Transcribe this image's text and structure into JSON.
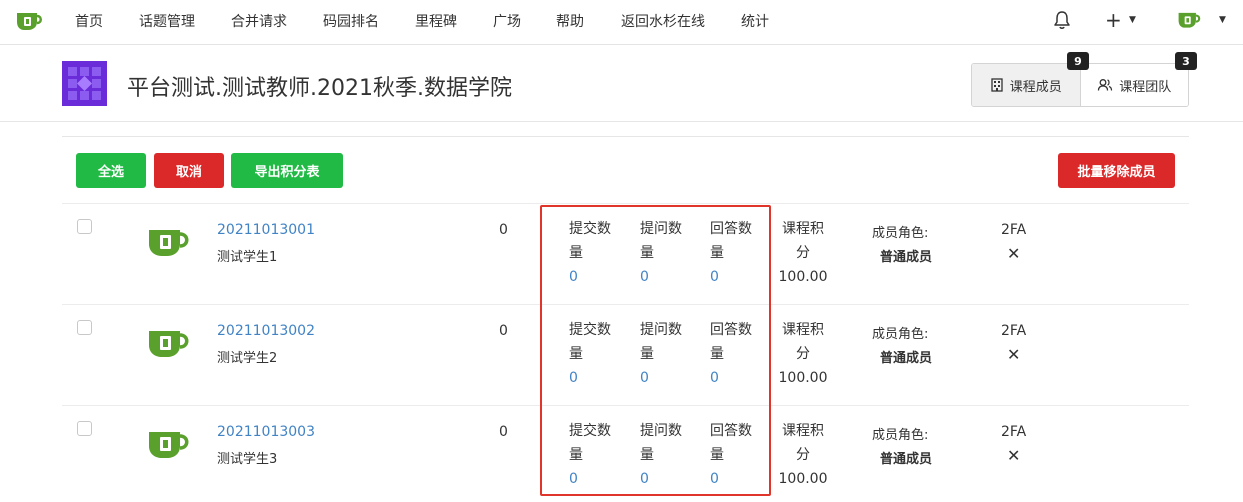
{
  "nav": {
    "items": [
      "首页",
      "话题管理",
      "合并请求",
      "码园排名",
      "里程碑",
      "广场",
      "帮助",
      "返回水杉在线",
      "统计"
    ]
  },
  "header": {
    "title": "平台测试.测试教师.2021秋季.数据学院",
    "tabs": [
      {
        "label": "课程成员",
        "count": "9"
      },
      {
        "label": "课程团队",
        "count": "3"
      }
    ]
  },
  "toolbar": {
    "select_all": "全选",
    "cancel": "取消",
    "export": "导出积分表",
    "batch_remove": "批量移除成员"
  },
  "members": [
    {
      "id": "20211013001",
      "name": "测试学生1",
      "count": "0",
      "stats": [
        {
          "label": "提交数量",
          "value": "0"
        },
        {
          "label": "提问数量",
          "value": "0"
        },
        {
          "label": "回答数量",
          "value": "0"
        }
      ],
      "score_label": "课程积分",
      "score": "100.00",
      "role_label": "成员角色:",
      "role": "普通成员",
      "twofa": "2FA"
    },
    {
      "id": "20211013002",
      "name": "测试学生2",
      "count": "0",
      "stats": [
        {
          "label": "提交数量",
          "value": "0"
        },
        {
          "label": "提问数量",
          "value": "0"
        },
        {
          "label": "回答数量",
          "value": "0"
        }
      ],
      "score_label": "课程积分",
      "score": "100.00",
      "role_label": "成员角色:",
      "role": "普通成员",
      "twofa": "2FA"
    },
    {
      "id": "20211013003",
      "name": "测试学生3",
      "count": "0",
      "stats": [
        {
          "label": "提交数量",
          "value": "0"
        },
        {
          "label": "提问数量",
          "value": "0"
        },
        {
          "label": "回答数量",
          "value": "0"
        }
      ],
      "score_label": "课程积分",
      "score": "100.00",
      "role_label": "成员角色:",
      "role": "普通成员",
      "twofa": "2FA"
    }
  ],
  "colors": {
    "primary_green": "#21ba45",
    "danger_red": "#db2828",
    "link_blue": "#4183c4",
    "highlight_red": "#e0352b",
    "logo_green": "#5aa02c",
    "course_icon_purple": "#6a2bd9"
  },
  "icons": {
    "logo": "teacup-logo-icon",
    "bell": "bell-icon",
    "plus": "plus-icon",
    "members_tab": "building-icon",
    "team_tab": "users-icon",
    "close": "x-icon"
  }
}
